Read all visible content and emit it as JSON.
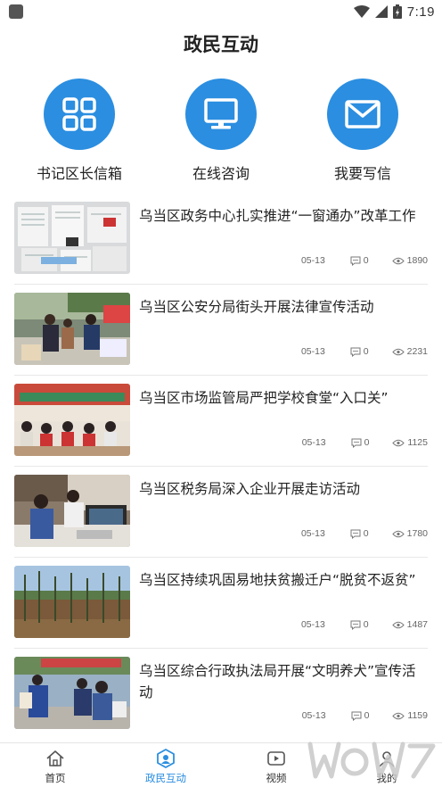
{
  "status_bar": {
    "time": "7:19"
  },
  "header": {
    "title": "政民互动"
  },
  "quick_actions": [
    {
      "label": "书记区长信箱",
      "icon": "grid-icon"
    },
    {
      "label": "在线咨询",
      "icon": "monitor-icon"
    },
    {
      "label": "我要写信",
      "icon": "envelope-icon"
    }
  ],
  "news": [
    {
      "title": "乌当区政务中心扎实推进“一窗通办”改革工作",
      "date": "05-13",
      "comments": "0",
      "views": "1890"
    },
    {
      "title": "乌当区公安分局街头开展法律宣传活动",
      "date": "05-13",
      "comments": "0",
      "views": "2231"
    },
    {
      "title": "乌当区市场监管局严把学校食堂“入口关”",
      "date": "05-13",
      "comments": "0",
      "views": "1125"
    },
    {
      "title": "乌当区税务局深入企业开展走访活动",
      "date": "05-13",
      "comments": "0",
      "views": "1780"
    },
    {
      "title": "乌当区持续巩固易地扶贫搬迁户“脱贫不返贫”",
      "date": "05-13",
      "comments": "0",
      "views": "1487"
    },
    {
      "title": "乌当区综合行政执法局开展“文明养犬”宣传活动",
      "date": "05-13",
      "comments": "0",
      "views": "1159"
    }
  ],
  "tabs": [
    {
      "label": "首页",
      "icon": "home-icon",
      "active": false
    },
    {
      "label": "政民互动",
      "icon": "hexagon-user-icon",
      "active": true
    },
    {
      "label": "视频",
      "icon": "video-icon",
      "active": false
    },
    {
      "label": "我的",
      "icon": "user-icon",
      "active": false
    }
  ],
  "colors": {
    "accent": "#2b8ee0",
    "text": "#222222",
    "meta": "#666666",
    "divider": "#e8e8e8"
  }
}
